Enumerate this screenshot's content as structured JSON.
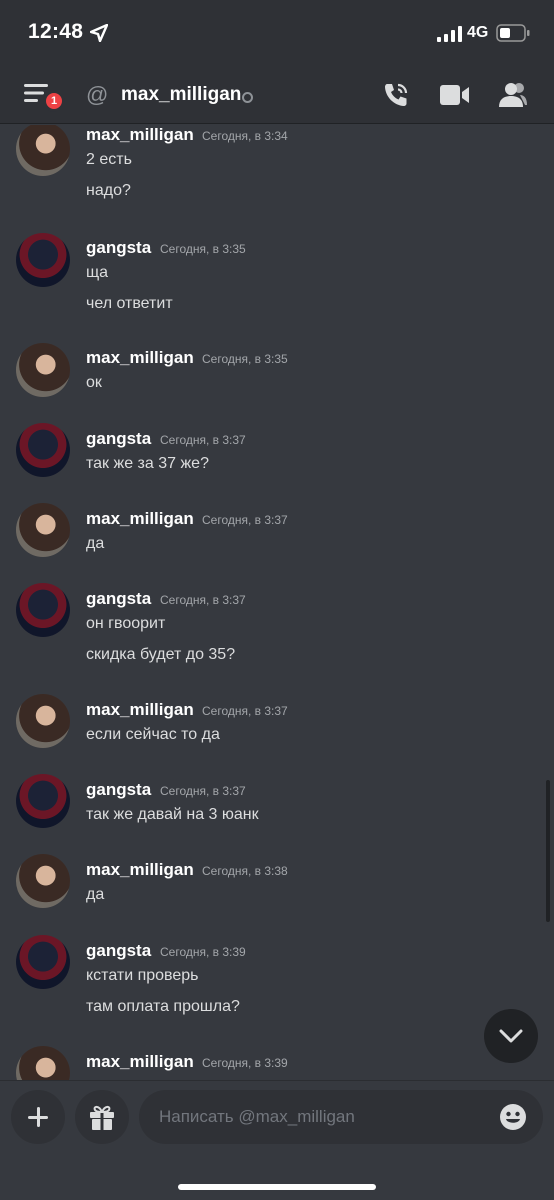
{
  "status_bar": {
    "time": "12:48",
    "network": "4G"
  },
  "header": {
    "badge_count": "1",
    "channel_name": "max_milligan"
  },
  "messages": [
    {
      "user": "max_milligan",
      "time": "Сегодня, в 3:34",
      "avatar": "avatar-female",
      "lines": [
        "2 есть",
        "надо?"
      ]
    },
    {
      "user": "gangsta",
      "time": "Сегодня, в 3:35",
      "avatar": "avatar-gangsta",
      "lines": [
        "ща",
        "чел ответит"
      ]
    },
    {
      "user": "max_milligan",
      "time": "Сегодня, в 3:35",
      "avatar": "avatar-female",
      "lines": [
        "ок"
      ]
    },
    {
      "user": "gangsta",
      "time": "Сегодня, в 3:37",
      "avatar": "avatar-gangsta",
      "lines": [
        "так же за 37 же?"
      ]
    },
    {
      "user": "max_milligan",
      "time": "Сегодня, в 3:37",
      "avatar": "avatar-female",
      "lines": [
        "да"
      ]
    },
    {
      "user": "gangsta",
      "time": "Сегодня, в 3:37",
      "avatar": "avatar-gangsta",
      "lines": [
        "он гвоорит",
        "скидка будет до 35?"
      ]
    },
    {
      "user": "max_milligan",
      "time": "Сегодня, в 3:37",
      "avatar": "avatar-female",
      "lines": [
        "если сейчас то да"
      ]
    },
    {
      "user": "gangsta",
      "time": "Сегодня, в 3:37",
      "avatar": "avatar-gangsta",
      "lines": [
        "так же давай на 3 юанк"
      ]
    },
    {
      "user": "max_milligan",
      "time": "Сегодня, в 3:38",
      "avatar": "avatar-female",
      "lines": [
        "да"
      ]
    },
    {
      "user": "gangsta",
      "time": "Сегодня, в 3:39",
      "avatar": "avatar-gangsta",
      "lines": [
        "кстати проверь",
        "там оплата прошла?"
      ]
    },
    {
      "user": "max_milligan",
      "time": "Сегодня, в 3:39",
      "avatar": "avatar-female",
      "lines": []
    }
  ],
  "composer": {
    "placeholder": "Написать @max_milligan"
  },
  "colors": {
    "background": "#36393f",
    "header": "#2f3136",
    "badge": "#ed4245",
    "text": "#dcddde"
  }
}
